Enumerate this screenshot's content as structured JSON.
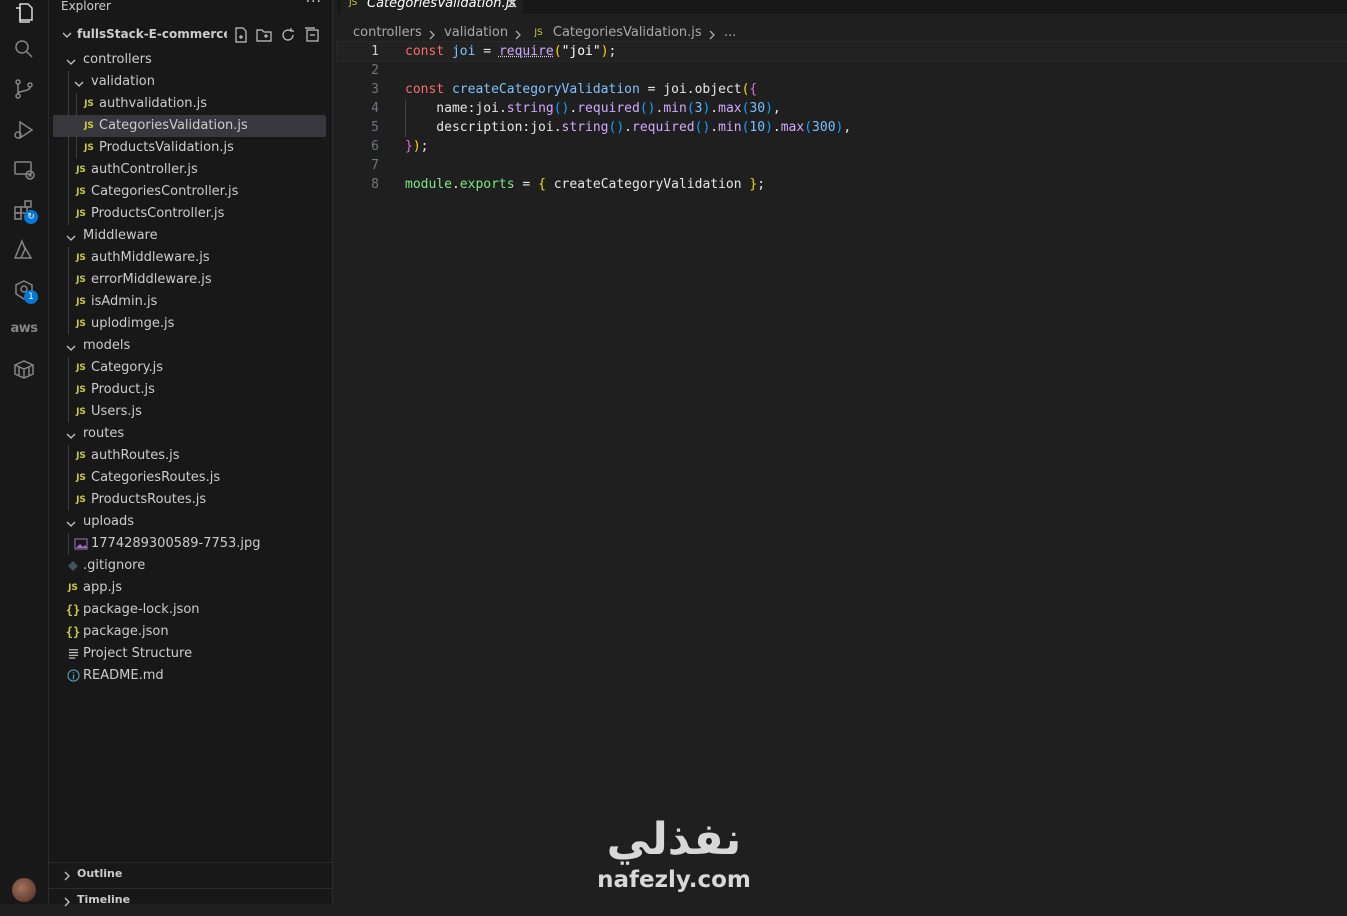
{
  "sidebar": {
    "title": "Explorer",
    "more": "···",
    "project": "fullsStack-E-commerce-m...",
    "tree": [
      {
        "label": "controllers",
        "type": "folder",
        "depth": 1
      },
      {
        "label": "validation",
        "type": "folder",
        "depth": 2
      },
      {
        "label": "authvalidation.js",
        "type": "js",
        "depth": 3,
        "icon": "JS"
      },
      {
        "label": "CategoriesValidation.js",
        "type": "js",
        "depth": 3,
        "icon": "JS",
        "selected": true
      },
      {
        "label": "ProductsValidation.js",
        "type": "js",
        "depth": 3,
        "icon": "JS"
      },
      {
        "label": "authController.js",
        "type": "js",
        "depth": 2,
        "icon": "JS"
      },
      {
        "label": "CategoriesController.js",
        "type": "js",
        "depth": 2,
        "icon": "JS"
      },
      {
        "label": "ProductsController.js",
        "type": "js",
        "depth": 2,
        "icon": "JS"
      },
      {
        "label": "Middleware",
        "type": "folder",
        "depth": 1
      },
      {
        "label": "authMiddleware.js",
        "type": "js",
        "depth": 2,
        "icon": "JS"
      },
      {
        "label": "errorMiddleware.js",
        "type": "js",
        "depth": 2,
        "icon": "JS"
      },
      {
        "label": "isAdmin.js",
        "type": "js",
        "depth": 2,
        "icon": "JS"
      },
      {
        "label": "uplodimge.js",
        "type": "js",
        "depth": 2,
        "icon": "JS"
      },
      {
        "label": "models",
        "type": "folder",
        "depth": 1
      },
      {
        "label": "Category.js",
        "type": "js",
        "depth": 2,
        "icon": "JS"
      },
      {
        "label": "Product.js",
        "type": "js",
        "depth": 2,
        "icon": "JS"
      },
      {
        "label": "Users.js",
        "type": "js",
        "depth": 2,
        "icon": "JS"
      },
      {
        "label": "routes",
        "type": "folder",
        "depth": 1
      },
      {
        "label": "authRoutes.js",
        "type": "js",
        "depth": 2,
        "icon": "JS"
      },
      {
        "label": "CategoriesRoutes.js",
        "type": "js",
        "depth": 2,
        "icon": "JS"
      },
      {
        "label": "ProductsRoutes.js",
        "type": "js",
        "depth": 2,
        "icon": "JS"
      },
      {
        "label": "uploads",
        "type": "folder",
        "depth": 1
      },
      {
        "label": "1774289300589-7753.jpg",
        "type": "image",
        "depth": 2
      },
      {
        "label": ".gitignore",
        "type": "gitignore",
        "depth": 1
      },
      {
        "label": "app.js",
        "type": "js",
        "depth": 1,
        "icon": "JS"
      },
      {
        "label": "package-lock.json",
        "type": "json",
        "depth": 1,
        "icon": "{}"
      },
      {
        "label": "package.json",
        "type": "json",
        "depth": 1,
        "icon": "{}"
      },
      {
        "label": "Project Structure",
        "type": "text",
        "depth": 1
      },
      {
        "label": "README.md",
        "type": "info",
        "depth": 1
      }
    ],
    "outline": "Outline",
    "timeline": "Timeline"
  },
  "activity_icons": [
    "explorer-icon",
    "search-icon",
    "source-control-icon",
    "run-debug-icon",
    "remote-explorer-icon",
    "extensions-icon",
    "azure-icon",
    "docker-icon",
    "aws-icon",
    "containers-icon"
  ],
  "activity_badges": {
    "docker": "1"
  },
  "aws_label": "aws",
  "editor": {
    "tab_icon": "JS",
    "tab_label": "CategoriesValidation.js",
    "breadcrumb": [
      "controllers",
      "validation",
      "CategoriesValidation.js",
      "..."
    ],
    "breadcrumb_icon": "JS",
    "current_line": 1,
    "lines": [
      [
        [
          "kw",
          "const "
        ],
        [
          "id",
          "joi"
        ],
        [
          "def",
          " = "
        ],
        [
          "fn u",
          "require"
        ],
        [
          "br1",
          "("
        ],
        [
          "str",
          "\"joi\""
        ],
        [
          "br1",
          ")"
        ],
        [
          "def",
          ";"
        ]
      ],
      [],
      [
        [
          "kw",
          "const "
        ],
        [
          "id",
          "createCategoryValidation"
        ],
        [
          "def",
          " = "
        ],
        [
          "def",
          "joi"
        ],
        [
          "def",
          "."
        ],
        [
          "def",
          "object"
        ],
        [
          "br1",
          "("
        ],
        [
          "br2",
          "{"
        ]
      ],
      [
        [
          "def",
          "    name:"
        ],
        [
          "def",
          "joi"
        ],
        [
          "def",
          "."
        ],
        [
          "prop",
          "string"
        ],
        [
          "br3",
          "()"
        ],
        [
          "def",
          "."
        ],
        [
          "prop",
          "required"
        ],
        [
          "br3",
          "()"
        ],
        [
          "def",
          "."
        ],
        [
          "prop",
          "min"
        ],
        [
          "br3",
          "("
        ],
        [
          "num",
          "3"
        ],
        [
          "br3",
          ")"
        ],
        [
          "def",
          "."
        ],
        [
          "prop",
          "max"
        ],
        [
          "br3",
          "("
        ],
        [
          "num",
          "30"
        ],
        [
          "br3",
          ")"
        ],
        [
          "def",
          ","
        ]
      ],
      [
        [
          "def",
          "    description:"
        ],
        [
          "def",
          "joi"
        ],
        [
          "def",
          "."
        ],
        [
          "prop",
          "string"
        ],
        [
          "br3",
          "()"
        ],
        [
          "def",
          "."
        ],
        [
          "prop",
          "required"
        ],
        [
          "br3",
          "()"
        ],
        [
          "def",
          "."
        ],
        [
          "prop",
          "min"
        ],
        [
          "br3",
          "("
        ],
        [
          "num",
          "10"
        ],
        [
          "br3",
          ")"
        ],
        [
          "def",
          "."
        ],
        [
          "prop",
          "max"
        ],
        [
          "br3",
          "("
        ],
        [
          "num",
          "300"
        ],
        [
          "br3",
          ")"
        ],
        [
          "def",
          ","
        ]
      ],
      [
        [
          "br2",
          "}"
        ],
        [
          "br1",
          ")"
        ],
        [
          "def",
          ";"
        ]
      ],
      [],
      [
        [
          "mod",
          "module"
        ],
        [
          "def",
          "."
        ],
        [
          "mod",
          "exports"
        ],
        [
          "def",
          " = "
        ],
        [
          "br1",
          "{ "
        ],
        [
          "def",
          "createCategoryValidation "
        ],
        [
          "br1",
          "}"
        ],
        [
          "def",
          ";"
        ]
      ]
    ]
  },
  "watermark": {
    "arabic": "نفذلي",
    "latin": "nafezly.com"
  }
}
